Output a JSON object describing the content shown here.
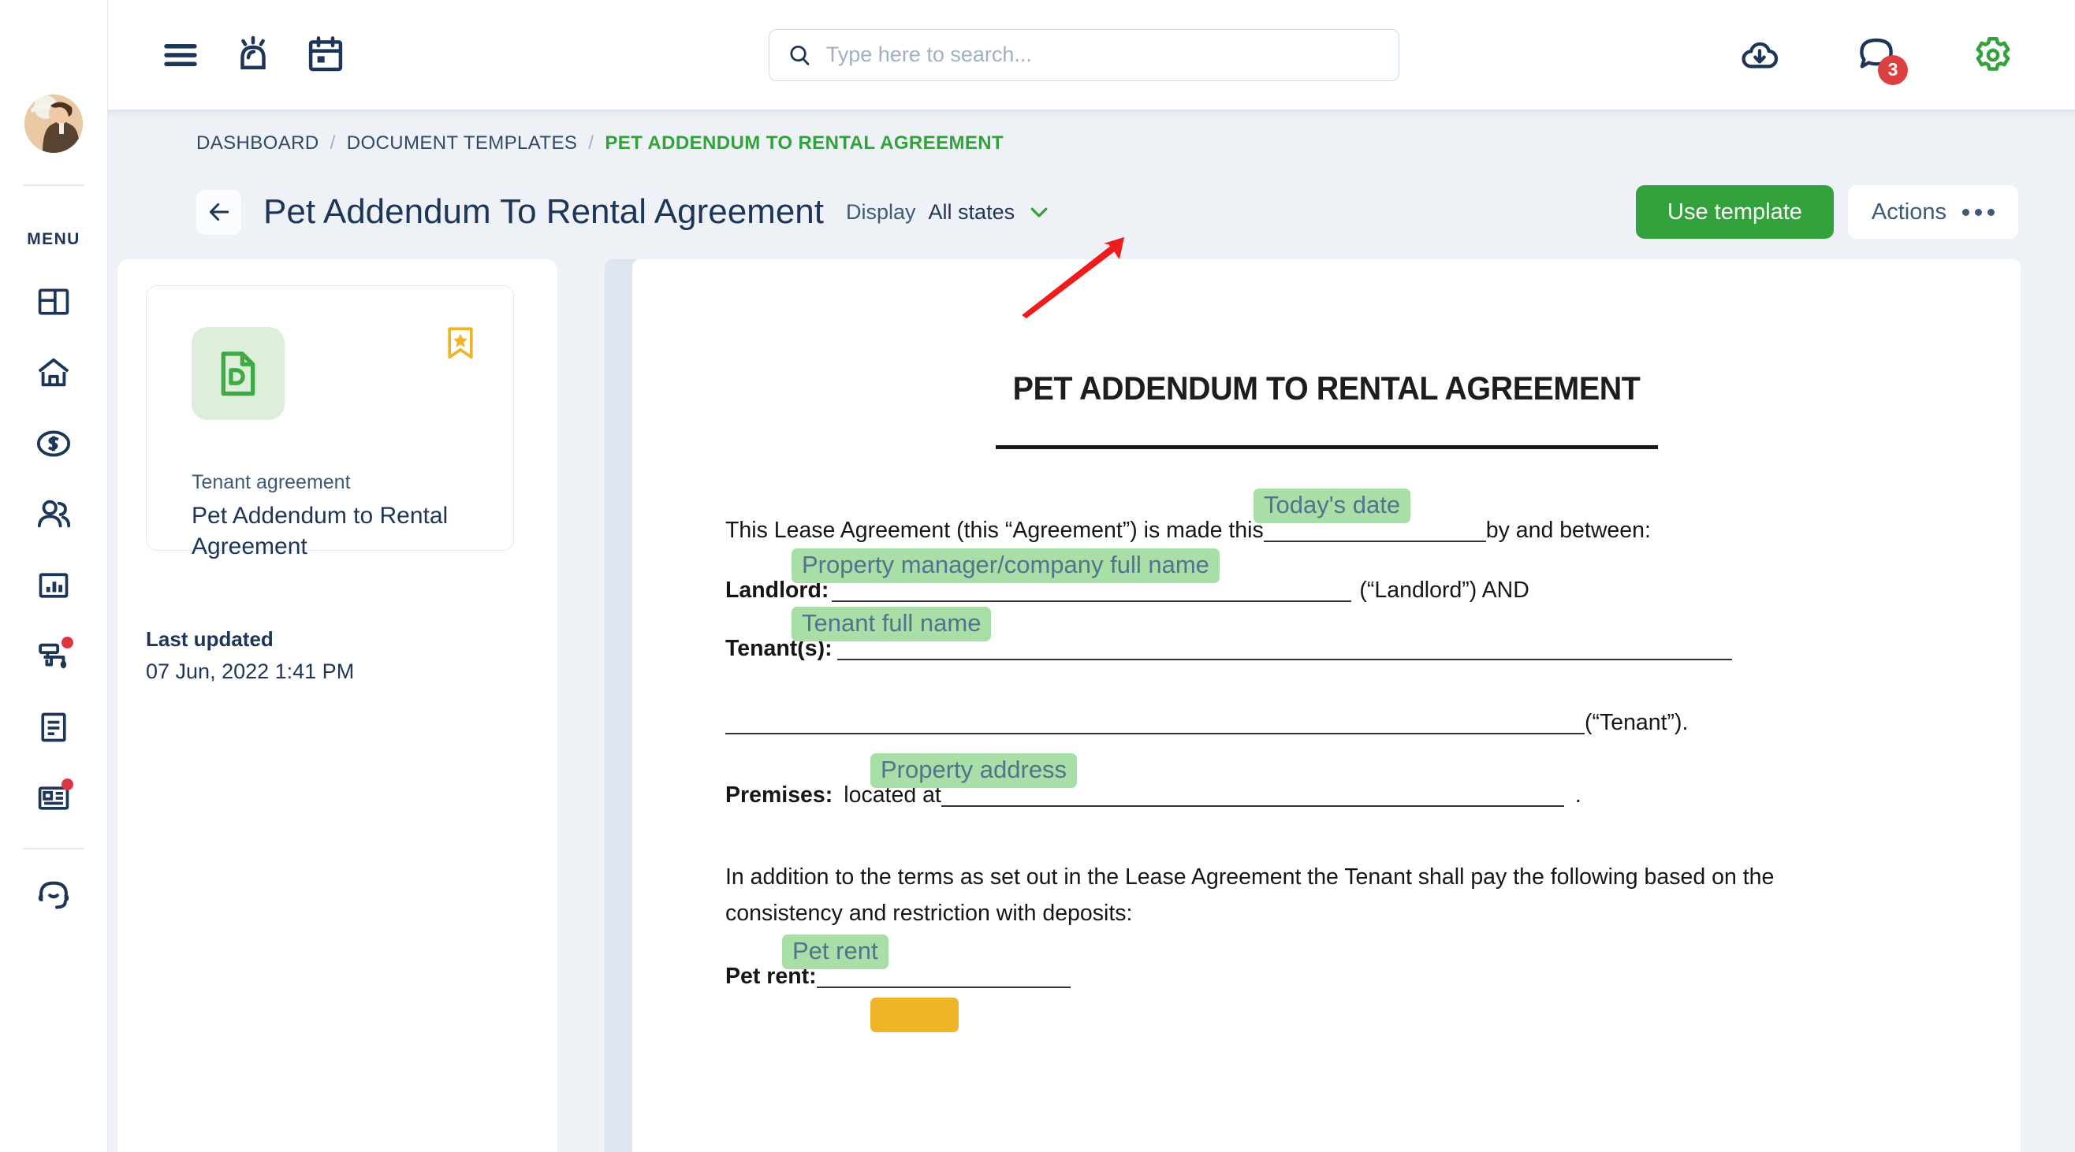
{
  "topbar": {
    "menu_icon": "hamburger-menu-icon",
    "alarm_icon": "alarm-bell-icon",
    "calendar_icon": "calendar-icon",
    "search": {
      "value": "",
      "placeholder": "Type here to search..."
    },
    "download_icon": "cloud-download-icon",
    "chat_icon": "chat-bubble-icon",
    "chat_badge": "3",
    "settings_icon": "gear-icon"
  },
  "sidebar": {
    "menu_label": "MENU",
    "avatar": "user-avatar",
    "items": [
      {
        "icon": "dashboard-grid-icon",
        "badge": false
      },
      {
        "icon": "home-icon",
        "badge": false
      },
      {
        "icon": "dollar-coin-icon",
        "badge": false
      },
      {
        "icon": "people-icon",
        "badge": false
      },
      {
        "icon": "bar-chart-icon",
        "badge": false
      },
      {
        "icon": "paint-roller-icon",
        "badge": true
      },
      {
        "icon": "document-text-icon",
        "badge": false
      },
      {
        "icon": "news-card-icon",
        "badge": true
      }
    ],
    "support": {
      "icon": "headset-support-icon"
    }
  },
  "breadcrumb": {
    "items": [
      {
        "label": "DASHBOARD",
        "active": false
      },
      {
        "label": "DOCUMENT TEMPLATES",
        "active": false
      },
      {
        "label": "PET ADDENDUM TO RENTAL AGREEMENT",
        "active": true
      }
    ],
    "separator": "/"
  },
  "page": {
    "back_icon": "arrow-left-icon",
    "title": "Pet Addendum To Rental Agreement",
    "display_label": "Display",
    "display_value": "All states",
    "display_chevron": "chevron-down-icon",
    "primary_button": "Use template",
    "secondary_button": "Actions"
  },
  "template_card": {
    "icon": "document-d-icon",
    "bookmark_icon": "bookmark-star-icon",
    "category": "Tenant agreement",
    "name": "Pet Addendum to Rental Agreement"
  },
  "meta": {
    "last_updated_label": "Last updated",
    "last_updated_value": "07 Jun, 2022 1:41 PM"
  },
  "document": {
    "title": "PET ADDENDUM TO RENTAL AGREEMENT",
    "line1_a": "This Lease Agreement (this “Agreement”) is made this",
    "line1_b": "by and between:",
    "hl_today": "Today's date",
    "landlord_label": "Landlord:",
    "landlord_suffix": "(“Landlord”) AND",
    "hl_manager": "Property manager/company full name",
    "tenant_label": "Tenant(s):",
    "hl_tenant": "Tenant full name",
    "tenant_suffix": "(“Tenant”).",
    "premises_label": "Premises:",
    "premises_text": "located at",
    "premises_period": ".",
    "hl_address": "Property address",
    "paragraph": "In addition to the terms as set out in the Lease Agreement the Tenant shall pay the following based on the consistency and restriction with deposits:",
    "petrent_label": "Pet rent:",
    "hl_petrent": "Pet rent"
  },
  "annotation": {
    "arrow": "red-arrow-pointing-to-use-template"
  },
  "colors": {
    "accent_green": "#33a13c",
    "navy": "#1d3557",
    "page_bg": "#eef2f7",
    "badge_red": "#dc4040",
    "highlight_green": "#a7dfa6",
    "bookmark_yellow": "#f0b429",
    "annotation_red": "#ee1c1c"
  }
}
